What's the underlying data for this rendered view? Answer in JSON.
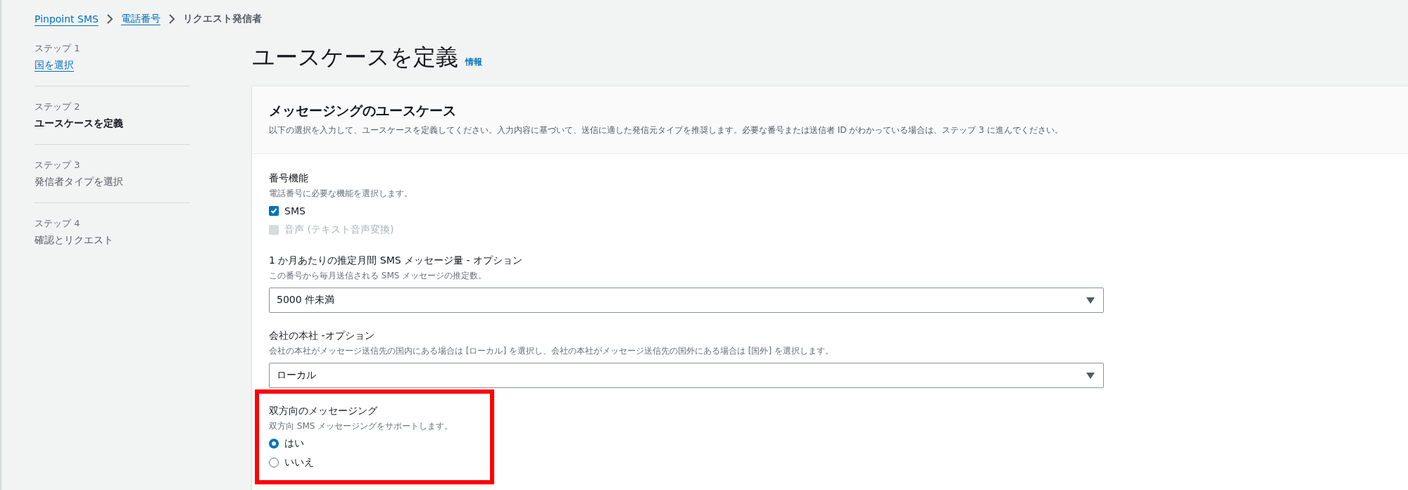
{
  "breadcrumbs": [
    {
      "label": "Pinpoint SMS",
      "link": true
    },
    {
      "label": "電話番号",
      "link": true
    },
    {
      "label": "リクエスト発信者",
      "link": false
    }
  ],
  "steps": [
    {
      "number": "ステップ 1",
      "label": "国を選択",
      "selected": false,
      "visited": true
    },
    {
      "number": "ステップ 2",
      "label": "ユースケースを定義",
      "selected": true,
      "visited": false
    },
    {
      "number": "ステップ 3",
      "label": "発信者タイプを選択",
      "selected": false,
      "visited": false
    },
    {
      "number": "ステップ 4",
      "label": "確認とリクエスト",
      "selected": false,
      "visited": false
    }
  ],
  "page_title": "ユースケースを定義",
  "info_link": "情報",
  "card": {
    "title": "メッセージングのユースケース",
    "description": "以下の選択を入力して、ユースケースを定義してください。入力内容に基づいて、送信に適した発信元タイプを推奨します。必要な番号または送信者 ID がわかっている場合は、ステップ 3 に進んでください。",
    "fields": [
      {
        "kind": "checkboxes",
        "label": "番号機能",
        "description": "電話番号に必要な機能を選択します。",
        "highlighted": false,
        "options": [
          {
            "label": "SMS",
            "checked": true,
            "disabled": false
          },
          {
            "label": "音声 (テキスト音声変換)",
            "checked": false,
            "disabled": true
          }
        ]
      },
      {
        "kind": "select",
        "label": "1 か月あたりの推定月間 SMS メッセージ量 - オプション",
        "description": "この番号から毎月送信される SMS メッセージの推定数。",
        "highlighted": false,
        "value": "5000 件未満"
      },
      {
        "kind": "select",
        "label": "会社の本社 -オプション",
        "description": "会社の本社がメッセージ送信先の国内にある場合は [ローカル] を選択し、会社の本社がメッセージ送信先の国外にある場合は [国外] を選択します。",
        "highlighted": false,
        "value": "ローカル"
      },
      {
        "kind": "radios",
        "label": "双方向のメッセージング",
        "description": "双方向 SMS メッセージングをサポートします。",
        "highlighted": true,
        "options": [
          {
            "label": "はい",
            "selected": true
          },
          {
            "label": "いいえ",
            "selected": false
          }
        ]
      }
    ]
  }
}
